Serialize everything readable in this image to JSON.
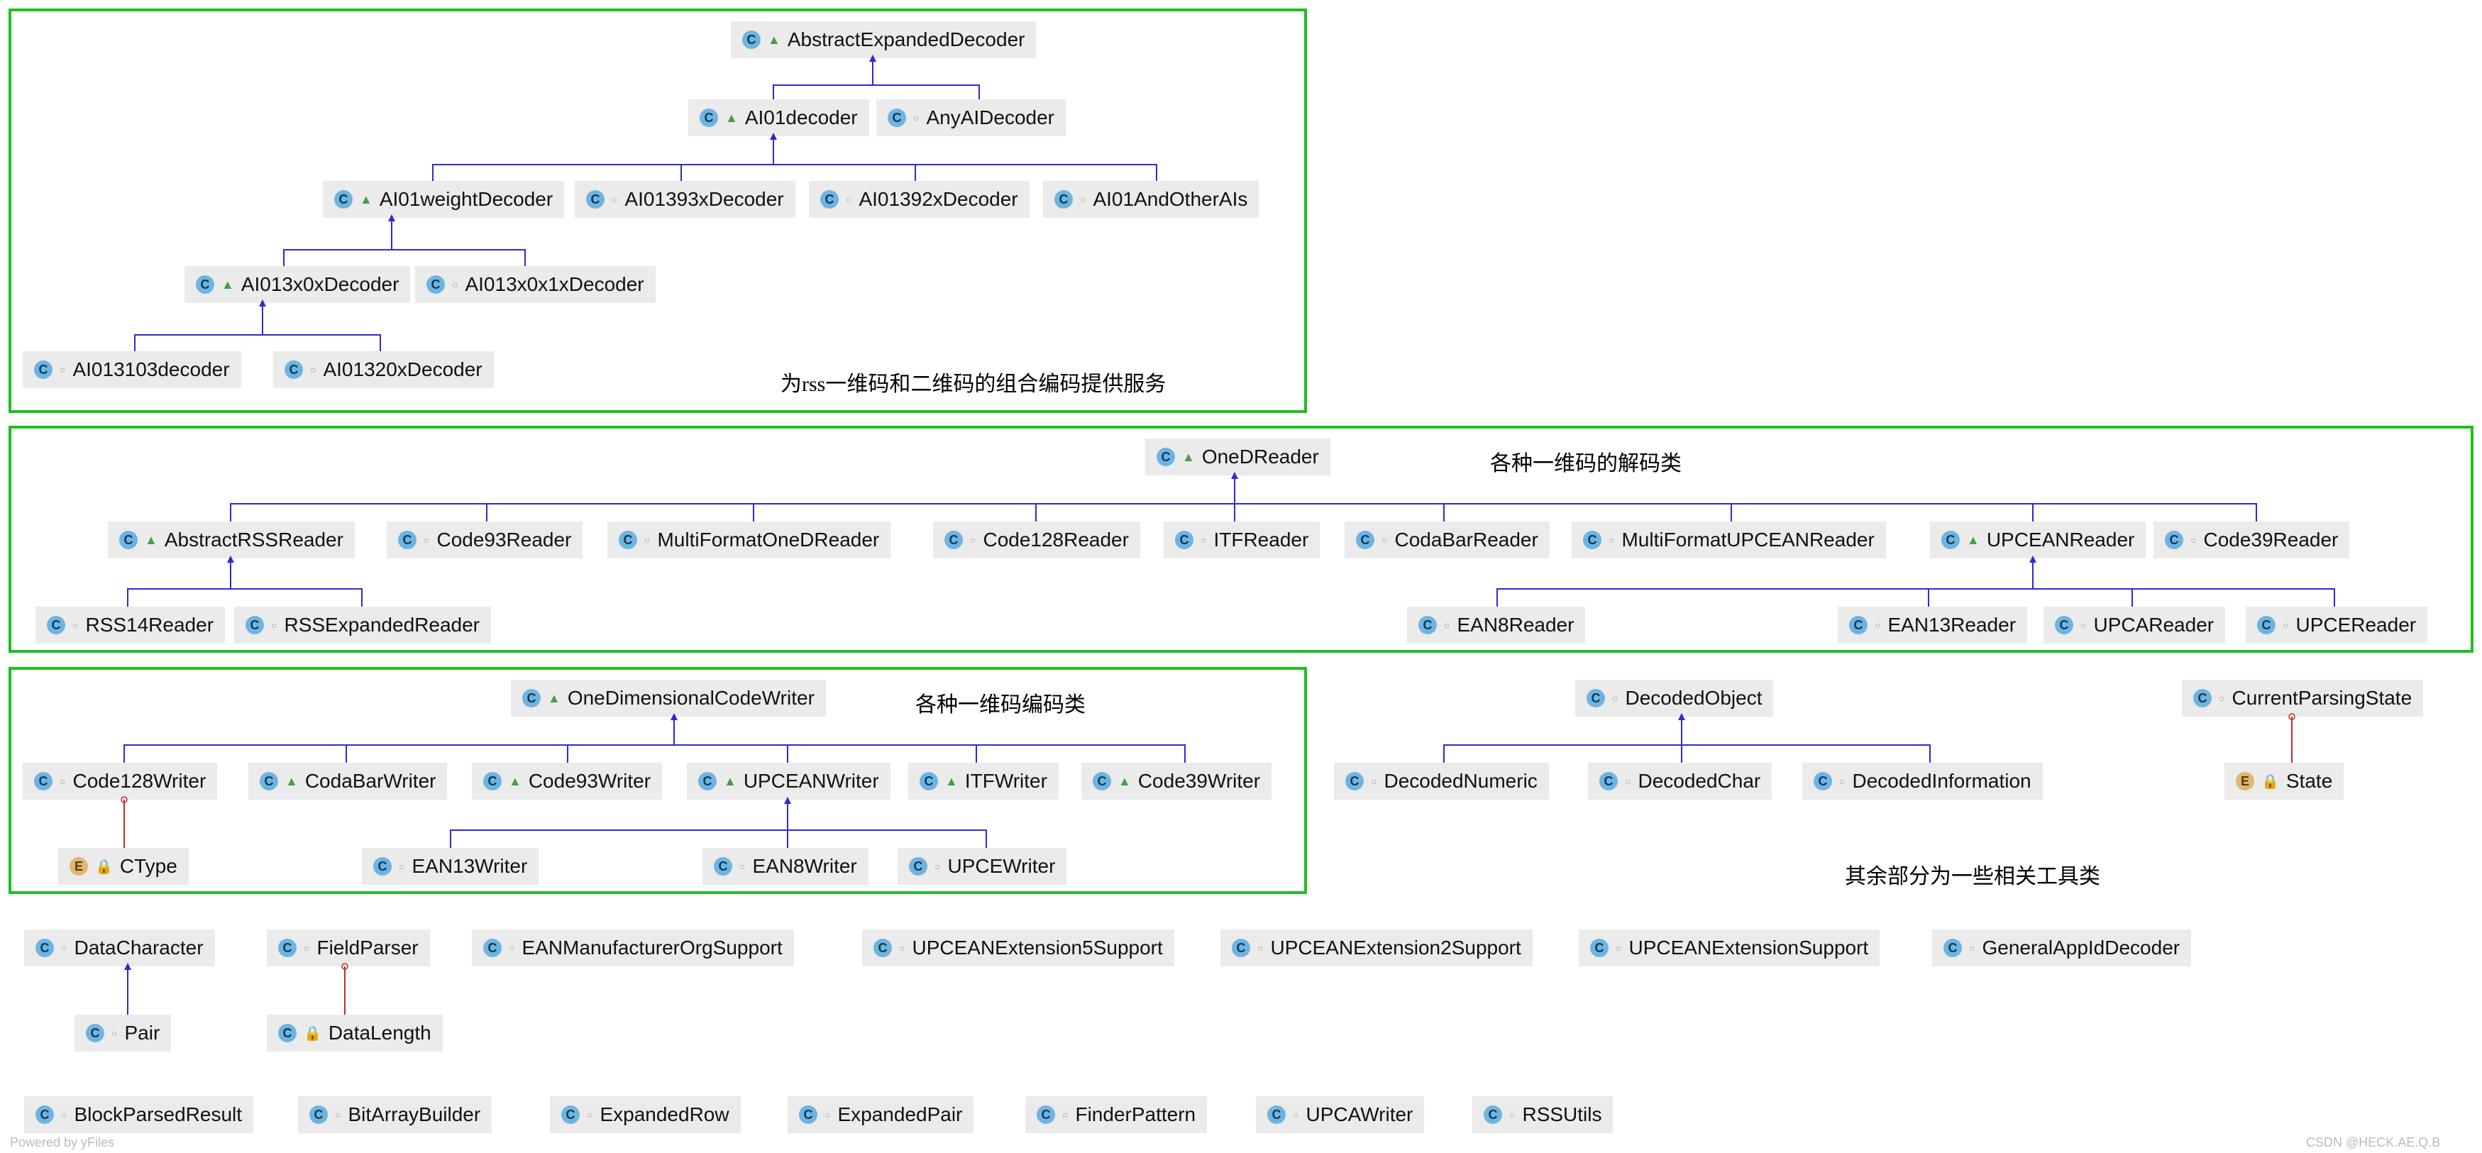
{
  "captions": {
    "group1": "为rss一维码和二维码的组合编码提供服务",
    "group2": "各种一维码的解码类",
    "group3": "各种一维码编码类",
    "group4": "其余部分为一些相关工具类"
  },
  "nodes": {
    "AbstractExpandedDecoder": "AbstractExpandedDecoder",
    "AI01decoder": "AI01decoder",
    "AnyAIDecoder": "AnyAIDecoder",
    "AI01weightDecoder": "AI01weightDecoder",
    "AI01393xDecoder": "AI01393xDecoder",
    "AI01392xDecoder": "AI01392xDecoder",
    "AI01AndOtherAIs": "AI01AndOtherAIs",
    "AI013x0xDecoder": "AI013x0xDecoder",
    "AI013x0x1xDecoder": "AI013x0x1xDecoder",
    "AI013103decoder": "AI013103decoder",
    "AI01320xDecoder": "AI01320xDecoder",
    "OneDReader": "OneDReader",
    "AbstractRSSReader": "AbstractRSSReader",
    "Code93Reader": "Code93Reader",
    "MultiFormatOneDReader": "MultiFormatOneDReader",
    "Code128Reader": "Code128Reader",
    "ITFReader": "ITFReader",
    "CodaBarReader": "CodaBarReader",
    "MultiFormatUPCEANReader": "MultiFormatUPCEANReader",
    "UPCEANReader": "UPCEANReader",
    "Code39Reader": "Code39Reader",
    "RSS14Reader": "RSS14Reader",
    "RSSExpandedReader": "RSSExpandedReader",
    "EAN8Reader": "EAN8Reader",
    "EAN13Reader": "EAN13Reader",
    "UPCAReader": "UPCAReader",
    "UPCEReader": "UPCEReader",
    "OneDimensionalCodeWriter": "OneDimensionalCodeWriter",
    "Code128Writer": "Code128Writer",
    "CodaBarWriter": "CodaBarWriter",
    "Code93Writer": "Code93Writer",
    "UPCEANWriter": "UPCEANWriter",
    "ITFWriter": "ITFWriter",
    "Code39Writer": "Code39Writer",
    "CType": "CType",
    "EAN13Writer": "EAN13Writer",
    "EAN8Writer": "EAN8Writer",
    "UPCEWriter": "UPCEWriter",
    "DecodedObject": "DecodedObject",
    "DecodedNumeric": "DecodedNumeric",
    "DecodedChar": "DecodedChar",
    "DecodedInformation": "DecodedInformation",
    "CurrentParsingState": "CurrentParsingState",
    "State": "State",
    "DataCharacter": "DataCharacter",
    "FieldParser": "FieldParser",
    "EANManufacturerOrgSupport": "EANManufacturerOrgSupport",
    "UPCEANExtension5Support": "UPCEANExtension5Support",
    "UPCEANExtension2Support": "UPCEANExtension2Support",
    "UPCEANExtensionSupport": "UPCEANExtensionSupport",
    "GeneralAppIdDecoder": "GeneralAppIdDecoder",
    "Pair": "Pair",
    "DataLength": "DataLength",
    "BlockParsedResult": "BlockParsedResult",
    "BitArrayBuilder": "BitArrayBuilder",
    "ExpandedRow": "ExpandedRow",
    "ExpandedPair": "ExpandedPair",
    "FinderPattern": "FinderPattern",
    "UPCAWriter": "UPCAWriter",
    "RSSUtils": "RSSUtils"
  },
  "watermarks": {
    "left": "Powered by yFiles",
    "right": "CSDN @HECK.AE.Q.B"
  }
}
